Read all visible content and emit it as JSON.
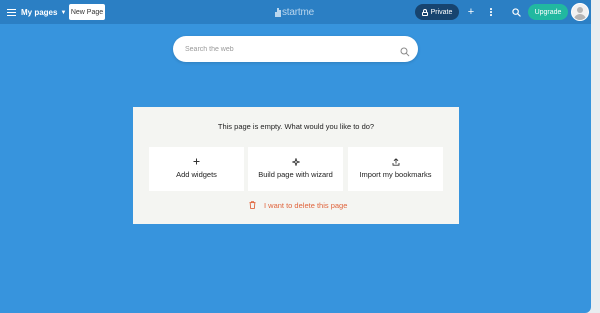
{
  "topbar": {
    "menu_label": "My pages",
    "new_page_label": "New Page",
    "logo_text": "startme",
    "private_label": "Private",
    "upgrade_label": "Upgrade"
  },
  "search": {
    "placeholder": "Search the web"
  },
  "empty_state": {
    "message": "This page is empty. What would you like to do?",
    "options": [
      {
        "label": "Add widgets",
        "icon": "plus-icon"
      },
      {
        "label": "Build page with wizard",
        "icon": "sparkle-icon"
      },
      {
        "label": "Import my bookmarks",
        "icon": "upload-icon"
      }
    ],
    "delete_label": "I want to delete this page"
  },
  "colors": {
    "background": "#3794dd",
    "topbar": "#2b7fc4",
    "private_button": "#17446f",
    "upgrade_button": "#21b8a0",
    "delete_text": "#e0643c",
    "panel": "#f4f5f2"
  }
}
